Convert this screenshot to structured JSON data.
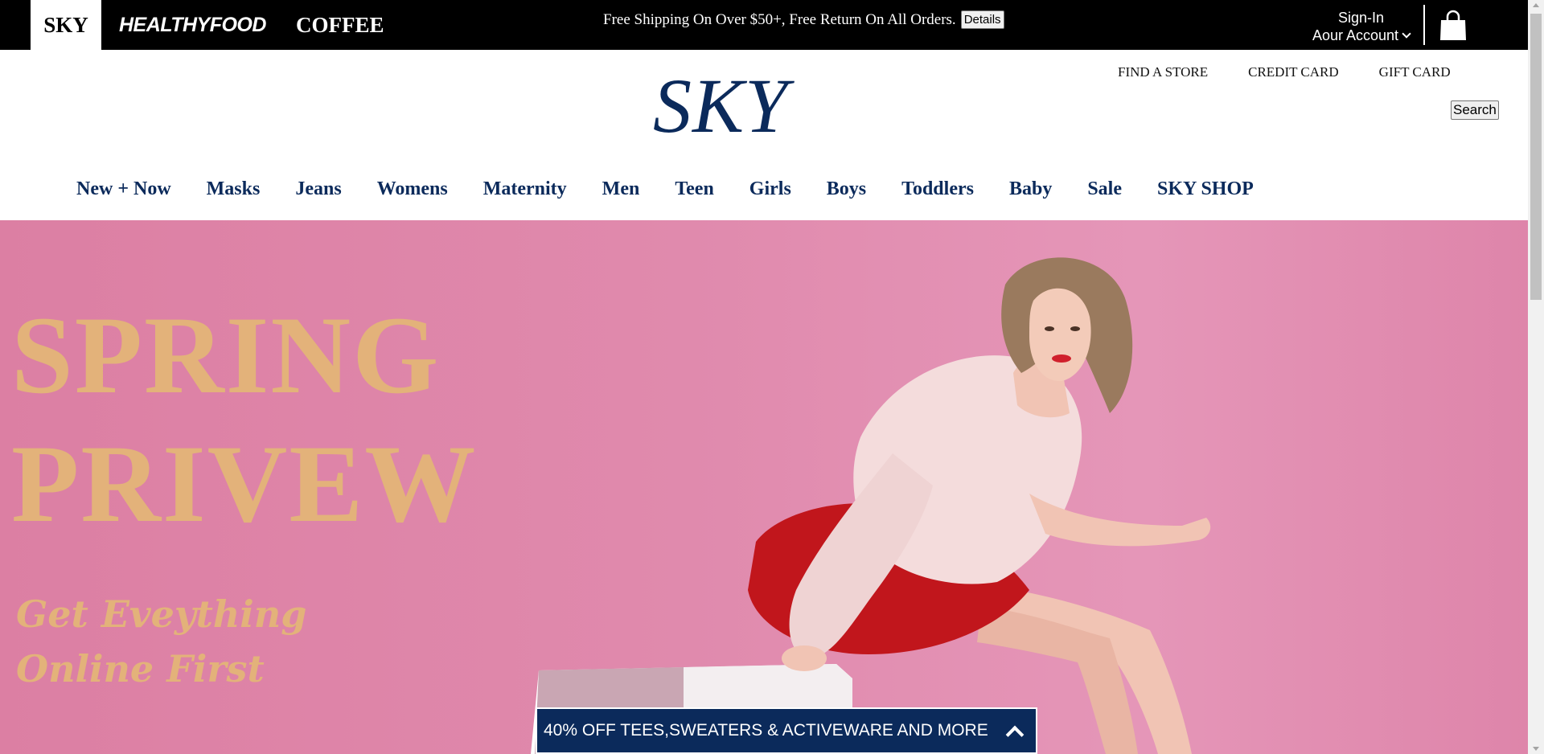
{
  "topbar": {
    "brands": [
      "SKY",
      "HEALTHYFOOD",
      "COFFEE"
    ],
    "promo_text": "Free Shipping On Over $50+, Free Return On All Orders.",
    "details_label": "Details",
    "signin_label": "Sign-In",
    "account_label": "Aour Account"
  },
  "header": {
    "logo": "SKY",
    "utility_links": [
      "FIND A STORE",
      "CREDIT CARD",
      "GIFT CARD"
    ],
    "search_label": "Search"
  },
  "nav": {
    "items": [
      "New + Now",
      "Masks",
      "Jeans",
      "Womens",
      "Maternity",
      "Men",
      "Teen",
      "Girls",
      "Boys",
      "Toddlers",
      "Baby",
      "Sale",
      "SKY SHOP"
    ]
  },
  "hero": {
    "title_line1": "SPRING",
    "title_line2": "PRIVEW",
    "subtitle_line1": "Get Eveything",
    "subtitle_line2": "Online First",
    "promo_bar": "40% OFF TEES,SWEATERS & ACTIVEWARE AND MORE"
  },
  "colors": {
    "navy": "#0b2a5b",
    "gold": "#e3b27a",
    "pink": "#e08aad"
  }
}
